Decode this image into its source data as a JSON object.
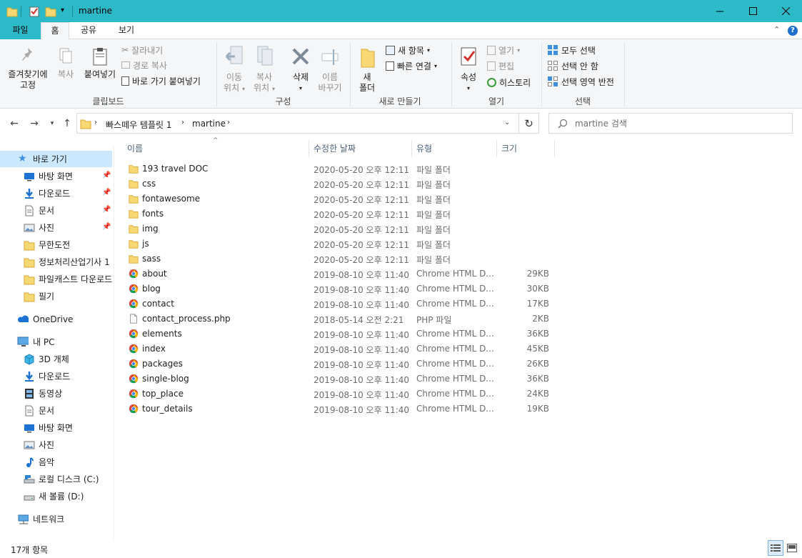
{
  "window": {
    "title": "martine",
    "accent": "#2cbac8"
  },
  "ribbon_tabs": {
    "file": "파일",
    "home": "홈",
    "share": "공유",
    "view": "보기"
  },
  "ribbon": {
    "clipboard": {
      "pin_quick": "즐겨찾기에\n고정",
      "pin_quick_l1": "즐겨찾기에",
      "pin_quick_l2": "고정",
      "copy": "복사",
      "paste": "붙여넣기",
      "cut": "잘라내기",
      "copy_path": "경로 복사",
      "paste_shortcut": "바로 가기 붙여넣기",
      "group": "클립보드"
    },
    "organize": {
      "move_l1": "이동",
      "move_l2": "위치",
      "copy_l1": "복사",
      "copy_l2": "위치",
      "delete": "삭제",
      "rename_l1": "이름",
      "rename_l2": "바꾸기",
      "group": "구성"
    },
    "new": {
      "new_folder_l1": "새",
      "new_folder_l2": "폴더",
      "new_item": "새 항목",
      "easy_access": "빠른 연결",
      "group": "새로 만들기"
    },
    "open": {
      "properties": "속성",
      "open": "열기",
      "edit": "편집",
      "history": "히스토리",
      "group": "열기"
    },
    "select": {
      "select_all": "모두 선택",
      "select_none": "선택 안 함",
      "invert": "선택 영역 반전",
      "group": "선택"
    }
  },
  "address": {
    "crumbs": [
      "빠스떼우 템플릿 1",
      "martine"
    ],
    "search_placeholder": "martine 검색"
  },
  "nav_pane": {
    "quick_access": "바로 가기",
    "quick_items": [
      {
        "label": "바탕 화면",
        "icon": "desktop-icon",
        "pinned": true
      },
      {
        "label": "다운로드",
        "icon": "download-icon",
        "pinned": true
      },
      {
        "label": "문서",
        "icon": "documents-icon",
        "pinned": true
      },
      {
        "label": "사진",
        "icon": "pictures-icon",
        "pinned": true
      },
      {
        "label": "무한도전",
        "icon": "folder-icon",
        "pinned": false
      },
      {
        "label": "정보처리산업기사 1",
        "icon": "folder-icon",
        "pinned": false
      },
      {
        "label": "파일캐스트 다운로드",
        "icon": "folder-icon",
        "pinned": false
      },
      {
        "label": "필기",
        "icon": "folder-icon",
        "pinned": false
      }
    ],
    "onedrive": "OneDrive",
    "this_pc": "내 PC",
    "pc_items": [
      {
        "label": "3D 개체",
        "icon": "3d-objects-icon"
      },
      {
        "label": "다운로드",
        "icon": "download-icon"
      },
      {
        "label": "동영상",
        "icon": "videos-icon"
      },
      {
        "label": "문서",
        "icon": "documents-icon"
      },
      {
        "label": "바탕 화면",
        "icon": "desktop-icon"
      },
      {
        "label": "사진",
        "icon": "pictures-icon"
      },
      {
        "label": "음악",
        "icon": "music-icon"
      },
      {
        "label": "로컬 디스크 (C:)",
        "icon": "drive-c-icon"
      },
      {
        "label": "새 볼륨 (D:)",
        "icon": "drive-d-icon"
      }
    ],
    "network": "네트워크"
  },
  "columns": {
    "name": "이름",
    "date": "수정한 날짜",
    "type": "유형",
    "size": "크기"
  },
  "files": [
    {
      "name": "193 travel DOC",
      "date": "2020-05-20 오후 12:11",
      "type": "파일 폴더",
      "size": "",
      "icon": "folder-icon"
    },
    {
      "name": "css",
      "date": "2020-05-20 오후 12:11",
      "type": "파일 폴더",
      "size": "",
      "icon": "folder-icon"
    },
    {
      "name": "fontawesome",
      "date": "2020-05-20 오후 12:11",
      "type": "파일 폴더",
      "size": "",
      "icon": "folder-icon"
    },
    {
      "name": "fonts",
      "date": "2020-05-20 오후 12:11",
      "type": "파일 폴더",
      "size": "",
      "icon": "folder-icon"
    },
    {
      "name": "img",
      "date": "2020-05-20 오후 12:11",
      "type": "파일 폴더",
      "size": "",
      "icon": "folder-icon"
    },
    {
      "name": "js",
      "date": "2020-05-20 오후 12:11",
      "type": "파일 폴더",
      "size": "",
      "icon": "folder-icon"
    },
    {
      "name": "sass",
      "date": "2020-05-20 오후 12:11",
      "type": "파일 폴더",
      "size": "",
      "icon": "folder-icon"
    },
    {
      "name": "about",
      "date": "2019-08-10 오후 11:40",
      "type": "Chrome HTML D...",
      "size": "29KB",
      "icon": "chrome-html-icon"
    },
    {
      "name": "blog",
      "date": "2019-08-10 오후 11:40",
      "type": "Chrome HTML D...",
      "size": "30KB",
      "icon": "chrome-html-icon"
    },
    {
      "name": "contact",
      "date": "2019-08-10 오후 11:40",
      "type": "Chrome HTML D...",
      "size": "17KB",
      "icon": "chrome-html-icon"
    },
    {
      "name": "contact_process.php",
      "date": "2018-05-14 오전 2:21",
      "type": "PHP 파일",
      "size": "2KB",
      "icon": "php-file-icon"
    },
    {
      "name": "elements",
      "date": "2019-08-10 오후 11:40",
      "type": "Chrome HTML D...",
      "size": "36KB",
      "icon": "chrome-html-icon"
    },
    {
      "name": "index",
      "date": "2019-08-10 오후 11:40",
      "type": "Chrome HTML D...",
      "size": "45KB",
      "icon": "chrome-html-icon"
    },
    {
      "name": "packages",
      "date": "2019-08-10 오후 11:40",
      "type": "Chrome HTML D...",
      "size": "26KB",
      "icon": "chrome-html-icon"
    },
    {
      "name": "single-blog",
      "date": "2019-08-10 오후 11:40",
      "type": "Chrome HTML D...",
      "size": "36KB",
      "icon": "chrome-html-icon"
    },
    {
      "name": "top_place",
      "date": "2019-08-10 오후 11:40",
      "type": "Chrome HTML D...",
      "size": "24KB",
      "icon": "chrome-html-icon"
    },
    {
      "name": "tour_details",
      "date": "2019-08-10 오후 11:40",
      "type": "Chrome HTML D...",
      "size": "19KB",
      "icon": "chrome-html-icon"
    }
  ],
  "status": {
    "count": "17개 항목"
  }
}
